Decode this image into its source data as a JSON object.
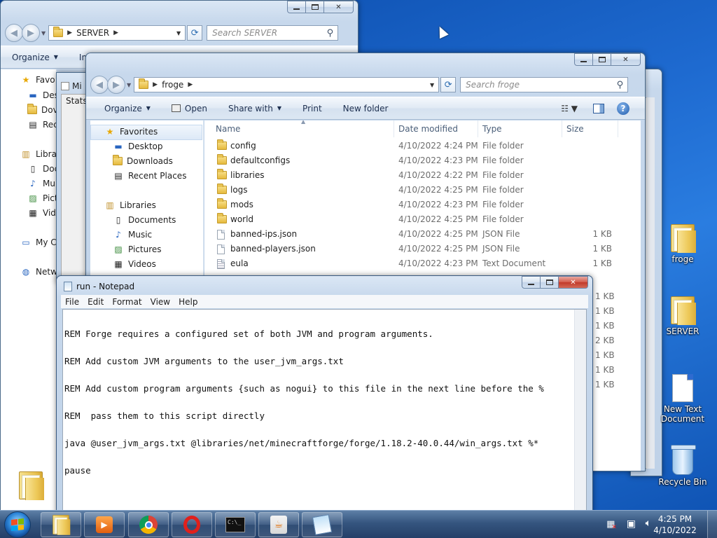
{
  "server_window": {
    "path": "SERVER",
    "search_placeholder": "Search SERVER",
    "organize": "Organize",
    "include_partial": "In",
    "nav_items": [
      "Favo",
      "Des",
      "Dov",
      "Rec",
      "Libra",
      "Doc",
      "Mu",
      "Pict",
      "Vid",
      "My C",
      "Netw"
    ]
  },
  "bg_window": {
    "title_partial": "Mi",
    "stats_label": "Stats"
  },
  "froge_window": {
    "path": "froge",
    "search_placeholder": "Search froge",
    "commands": {
      "organize": "Organize",
      "open": "Open",
      "share_with": "Share with",
      "print": "Print",
      "new_folder": "New folder"
    },
    "nav": {
      "favorites": "Favorites",
      "desktop": "Desktop",
      "downloads": "Downloads",
      "recent_places": "Recent Places",
      "libraries": "Libraries",
      "documents": "Documents",
      "music": "Music",
      "pictures": "Pictures",
      "videos": "Videos"
    },
    "columns": {
      "name": "Name",
      "date": "Date modified",
      "type": "Type",
      "size": "Size"
    },
    "files": [
      {
        "name": "config",
        "date": "4/10/2022 4:24 PM",
        "type": "File folder",
        "size": "",
        "icon": "folder-icon"
      },
      {
        "name": "defaultconfigs",
        "date": "4/10/2022 4:23 PM",
        "type": "File folder",
        "size": "",
        "icon": "folder-icon"
      },
      {
        "name": "libraries",
        "date": "4/10/2022 4:22 PM",
        "type": "File folder",
        "size": "",
        "icon": "folder-icon"
      },
      {
        "name": "logs",
        "date": "4/10/2022 4:25 PM",
        "type": "File folder",
        "size": "",
        "icon": "folder-icon"
      },
      {
        "name": "mods",
        "date": "4/10/2022 4:23 PM",
        "type": "File folder",
        "size": "",
        "icon": "folder-icon"
      },
      {
        "name": "world",
        "date": "4/10/2022 4:25 PM",
        "type": "File folder",
        "size": "",
        "icon": "folder-icon"
      },
      {
        "name": "banned-ips.json",
        "date": "4/10/2022 4:25 PM",
        "type": "JSON File",
        "size": "1 KB",
        "icon": "file-icon"
      },
      {
        "name": "banned-players.json",
        "date": "4/10/2022 4:25 PM",
        "type": "JSON File",
        "size": "1 KB",
        "icon": "file-icon"
      },
      {
        "name": "eula",
        "date": "4/10/2022 4:23 PM",
        "type": "Text Document",
        "size": "1 KB",
        "icon": "text-file-icon"
      }
    ],
    "hidden_sizes": [
      "1 KB",
      "1 KB",
      "1 KB",
      "2 KB",
      "1 KB",
      "1 KB",
      "1 KB"
    ]
  },
  "notepad": {
    "title": "run - Notepad",
    "menu": [
      "File",
      "Edit",
      "Format",
      "View",
      "Help"
    ],
    "lines": [
      "REM Forge requires a configured set of both JVM and program arguments.",
      "REM Add custom JVM arguments to the user_jvm_args.txt",
      "REM Add custom program arguments {such as nogui} to this file in the next line before the %",
      "REM  pass them to this script directly",
      "java @user_jvm_args.txt @libraries/net/minecraftforge/forge/1.18.2-40.0.44/win_args.txt %*",
      "pause"
    ]
  },
  "desktop_icons": [
    {
      "label": "froge",
      "icon": "folder-icon"
    },
    {
      "label": "SERVER",
      "icon": "folder-icon"
    },
    {
      "label": "New Text Document",
      "icon": "text-document-icon"
    },
    {
      "label": "Recycle Bin",
      "icon": "recycle-bin-icon"
    }
  ],
  "taskbar": {
    "time": "4:25 PM",
    "date": "4/10/2022",
    "apps": [
      "windows-explorer",
      "media-player",
      "chrome",
      "opera",
      "command-prompt",
      "java",
      "notepad"
    ]
  },
  "colors": {
    "accent_blue": "#1e6ad0",
    "taskbar": "#35557f",
    "close_red": "#c03828"
  }
}
